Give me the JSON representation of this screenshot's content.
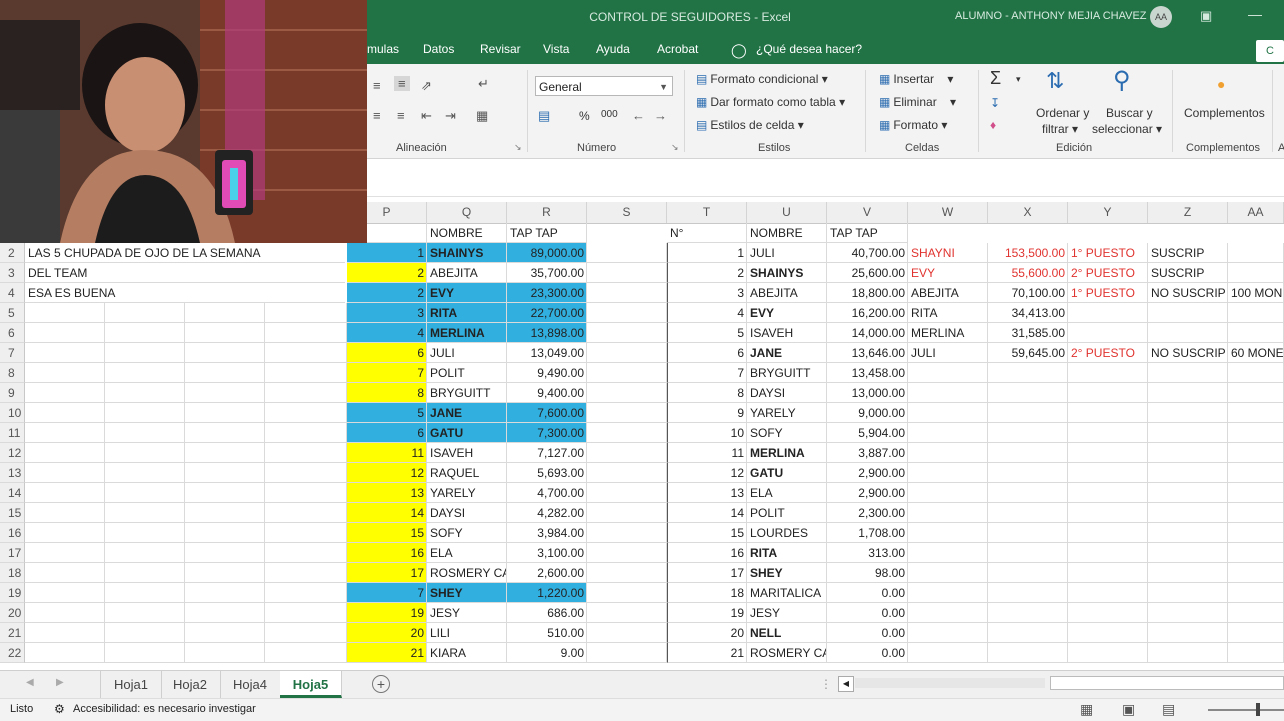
{
  "titlebar": {
    "title": "CONTROL DE SEGUIDORES  -  Excel",
    "user": "ALUMNO - ANTHONY MEJIA CHAVEZ",
    "initials": "AA"
  },
  "menu": [
    "mulas",
    "Datos",
    "Revisar",
    "Vista",
    "Ayuda",
    "Acrobat",
    "¿Qué desea hacer?"
  ],
  "share": "C",
  "ribbon": {
    "groups": {
      "alineacion": "Alineación",
      "numero": "Número",
      "estilos": "Estilos",
      "celdas": "Celdas",
      "edicion": "Edición",
      "complementos": "Complementos",
      "more": "A"
    },
    "number_format": "General",
    "estilos": {
      "condicional": "Formato condicional",
      "tabla": "Dar formato como tabla",
      "celda": "Estilos de celda"
    },
    "celdas": {
      "insertar": "Insertar",
      "eliminar": "Eliminar",
      "formato": "Formato"
    },
    "edicion": {
      "ordenar1": "Ordenar y",
      "ordenar2": "filtrar",
      "buscar1": "Buscar y",
      "buscar2": "seleccionar"
    },
    "complementos": "Complementos",
    "percent": "%",
    "thousands": "000"
  },
  "columns": [
    "P",
    "Q",
    "R",
    "S",
    "T",
    "U",
    "V",
    "W",
    "X",
    "Y",
    "Z",
    "AA"
  ],
  "rows": [
    {
      "n": "2",
      "a": "LAS 5 CHUPADA DE OJO DE LA SEMANA",
      "p": "1",
      "q": "SHAINYS",
      "r": "89,000.00",
      "pc": "cyan",
      "t": "1",
      "u": "JULI",
      "v": "40,700.00",
      "ub": false,
      "w": "SHAYNI",
      "wr": true,
      "x": "153,500.00",
      "xr": true,
      "y": "1° PUESTO",
      "z": "SUSCRIP",
      "aa": ""
    },
    {
      "n": "3",
      "a": "DEL TEAM",
      "p": "2",
      "q": "ABEJITA",
      "r": "35,700.00",
      "pc": "yel",
      "t": "2",
      "u": "SHAINYS",
      "v": "25,600.00",
      "ub": true,
      "w": "EVY",
      "wr": true,
      "x": "55,600.00",
      "xr": true,
      "y": "2° PUESTO",
      "z": "SUSCRIP",
      "aa": ""
    },
    {
      "n": "4",
      "a": "ESA ES BUENA",
      "p": "2",
      "q": "EVY",
      "r": "23,300.00",
      "pc": "cyan",
      "t": "3",
      "u": "ABEJITA",
      "v": "18,800.00",
      "ub": false,
      "w": "ABEJITA",
      "wr": false,
      "x": "70,100.00",
      "xr": false,
      "y": "1° PUESTO",
      "z": "NO SUSCRIP",
      "aa": "100 MON"
    },
    {
      "n": "5",
      "a": "",
      "p": "3",
      "q": "RITA",
      "r": "22,700.00",
      "pc": "cyan",
      "t": "4",
      "u": "EVY",
      "v": "16,200.00",
      "ub": true,
      "w": "RITA",
      "wr": false,
      "x": "34,413.00",
      "xr": false,
      "y": "",
      "z": "",
      "aa": ""
    },
    {
      "n": "6",
      "a": "",
      "p": "4",
      "q": "MERLINA",
      "r": "13,898.00",
      "pc": "cyan",
      "t": "5",
      "u": "ISAVEH",
      "v": "14,000.00",
      "ub": false,
      "w": "MERLINA",
      "wr": false,
      "x": "31,585.00",
      "xr": false,
      "y": "",
      "z": "",
      "aa": ""
    },
    {
      "n": "7",
      "a": "",
      "p": "6",
      "q": "JULI",
      "r": "13,049.00",
      "pc": "yel",
      "t": "6",
      "u": "JANE",
      "v": "13,646.00",
      "ub": true,
      "w": "JULI",
      "wr": false,
      "x": "59,645.00",
      "xr": false,
      "y": "2° PUESTO",
      "z": "NO SUSCRIP",
      "aa": "60 MONE"
    },
    {
      "n": "8",
      "a": "",
      "p": "7",
      "q": "POLIT",
      "r": "9,490.00",
      "pc": "yel",
      "t": "7",
      "u": "BRYGUITT",
      "v": "13,458.00",
      "ub": false,
      "w": "",
      "wr": false,
      "x": "",
      "xr": false,
      "y": "",
      "z": "",
      "aa": ""
    },
    {
      "n": "9",
      "a": "",
      "p": "8",
      "q": "BRYGUITT",
      "r": "9,400.00",
      "pc": "yel",
      "t": "8",
      "u": "DAYSI",
      "v": "13,000.00",
      "ub": false,
      "w": "",
      "wr": false,
      "x": "",
      "xr": false,
      "y": "",
      "z": "",
      "aa": ""
    },
    {
      "n": "10",
      "a": "",
      "p": "5",
      "q": "JANE",
      "r": "7,600.00",
      "pc": "cyan",
      "t": "9",
      "u": "YARELY",
      "v": "9,000.00",
      "ub": false,
      "w": "",
      "wr": false,
      "x": "",
      "xr": false,
      "y": "",
      "z": "",
      "aa": ""
    },
    {
      "n": "11",
      "a": "",
      "p": "6",
      "q": "GATU",
      "r": "7,300.00",
      "pc": "cyan",
      "t": "10",
      "u": "SOFY",
      "v": "5,904.00",
      "ub": false,
      "w": "",
      "wr": false,
      "x": "",
      "xr": false,
      "y": "",
      "z": "",
      "aa": ""
    },
    {
      "n": "12",
      "a": "",
      "p": "11",
      "q": "ISAVEH",
      "r": "7,127.00",
      "pc": "yel",
      "t": "11",
      "u": "MERLINA",
      "v": "3,887.00",
      "ub": true,
      "w": "",
      "wr": false,
      "x": "",
      "xr": false,
      "y": "",
      "z": "",
      "aa": ""
    },
    {
      "n": "13",
      "a": "",
      "p": "12",
      "q": "RAQUEL",
      "r": "5,693.00",
      "pc": "yel",
      "t": "12",
      "u": "GATU",
      "v": "2,900.00",
      "ub": true,
      "w": "",
      "wr": false,
      "x": "",
      "xr": false,
      "y": "",
      "z": "",
      "aa": ""
    },
    {
      "n": "14",
      "a": "",
      "p": "13",
      "q": "YARELY",
      "r": "4,700.00",
      "pc": "yel",
      "t": "13",
      "u": "ELA",
      "v": "2,900.00",
      "ub": false,
      "w": "",
      "wr": false,
      "x": "",
      "xr": false,
      "y": "",
      "z": "",
      "aa": ""
    },
    {
      "n": "15",
      "a": "",
      "p": "14",
      "q": "DAYSI",
      "r": "4,282.00",
      "pc": "yel",
      "t": "14",
      "u": "POLIT",
      "v": "2,300.00",
      "ub": false,
      "w": "",
      "wr": false,
      "x": "",
      "xr": false,
      "y": "",
      "z": "",
      "aa": ""
    },
    {
      "n": "16",
      "a": "",
      "p": "15",
      "q": "SOFY",
      "r": "3,984.00",
      "pc": "yel",
      "t": "15",
      "u": "LOURDES",
      "v": "1,708.00",
      "ub": false,
      "w": "",
      "wr": false,
      "x": "",
      "xr": false,
      "y": "",
      "z": "",
      "aa": ""
    },
    {
      "n": "17",
      "a": "",
      "p": "16",
      "q": "ELA",
      "r": "3,100.00",
      "pc": "yel",
      "t": "16",
      "u": "RITA",
      "v": "313.00",
      "ub": true,
      "w": "",
      "wr": false,
      "x": "",
      "xr": false,
      "y": "",
      "z": "",
      "aa": ""
    },
    {
      "n": "18",
      "a": "",
      "p": "17",
      "q": "ROSMERY CA",
      "r": "2,600.00",
      "pc": "yel",
      "t": "17",
      "u": "SHEY",
      "v": "98.00",
      "ub": true,
      "w": "",
      "wr": false,
      "x": "",
      "xr": false,
      "y": "",
      "z": "",
      "aa": ""
    },
    {
      "n": "19",
      "a": "",
      "p": "7",
      "q": "SHEY",
      "r": "1,220.00",
      "pc": "cyan",
      "t": "18",
      "u": "MARITALICA",
      "v": "0.00",
      "ub": false,
      "w": "",
      "wr": false,
      "x": "",
      "xr": false,
      "y": "",
      "z": "",
      "aa": ""
    },
    {
      "n": "20",
      "a": "",
      "p": "19",
      "q": "JESY",
      "r": "686.00",
      "pc": "yel",
      "t": "19",
      "u": "JESY",
      "v": "0.00",
      "ub": false,
      "w": "",
      "wr": false,
      "x": "",
      "xr": false,
      "y": "",
      "z": "",
      "aa": ""
    },
    {
      "n": "21",
      "a": "",
      "p": "20",
      "q": "LILI",
      "r": "510.00",
      "pc": "yel",
      "t": "20",
      "u": "NELL",
      "v": "0.00",
      "ub": true,
      "w": "",
      "wr": false,
      "x": "",
      "xr": false,
      "y": "",
      "z": "",
      "aa": ""
    },
    {
      "n": "22",
      "a": "",
      "p": "21",
      "q": "KIARA",
      "r": "9.00",
      "pc": "yel",
      "t": "21",
      "u": "ROSMERY CA",
      "v": "0.00",
      "ub": false,
      "w": "",
      "wr": false,
      "x": "",
      "xr": false,
      "y": "",
      "z": "",
      "aa": ""
    }
  ],
  "header_row": {
    "q": "NOMBRE",
    "r": "TAP TAP",
    "t": "N°",
    "u": "NOMBRE",
    "v": "TAP TAP"
  },
  "sheets": [
    "Hoja1",
    "Hoja2",
    "Hoja4",
    "Hoja5"
  ],
  "active_sheet": "Hoja5",
  "status": {
    "mode": "Listo",
    "accessibility": "Accesibilidad: es necesario investigar"
  },
  "colors": {
    "excel_green": "#217346",
    "cyan_fill": "#31b0e0",
    "yellow_fill": "#ffff00",
    "red_text": "#e0332f"
  }
}
